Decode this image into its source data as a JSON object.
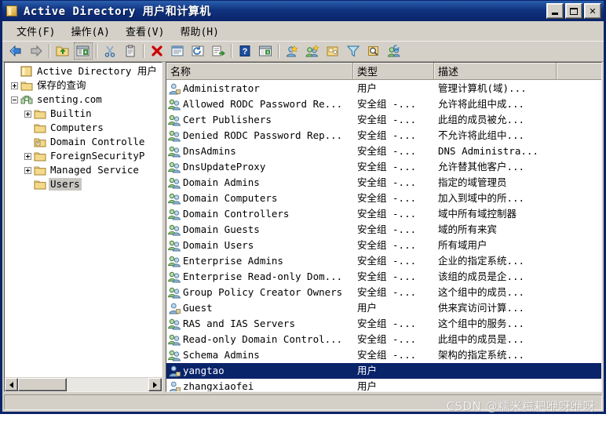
{
  "window": {
    "title": "Active Directory 用户和计算机",
    "icon": "folder-icon",
    "minimize_label": "最小化",
    "maximize_label": "最大化",
    "close_label": "✕"
  },
  "menu": {
    "items": [
      {
        "label": "文件(F)",
        "name": "menu-file"
      },
      {
        "label": "操作(A)",
        "name": "menu-action"
      },
      {
        "label": "查看(V)",
        "name": "menu-view"
      },
      {
        "label": "帮助(H)",
        "name": "menu-help"
      }
    ]
  },
  "toolbar": {
    "buttons": [
      {
        "icon": "back-arrow-icon",
        "label": "后退"
      },
      {
        "icon": "forward-arrow-icon",
        "label": "前进"
      },
      {
        "sep": true
      },
      {
        "icon": "up-folder-icon",
        "label": "上一级"
      },
      {
        "icon": "show-console-tree-icon",
        "label": "显示/隐藏控制台树",
        "pressed": true
      },
      {
        "sep": true
      },
      {
        "icon": "cut-scissors-icon",
        "label": "剪切"
      },
      {
        "icon": "paste-clipboard-icon",
        "label": "粘贴"
      },
      {
        "sep": true
      },
      {
        "icon": "delete-x-icon",
        "label": "删除"
      },
      {
        "icon": "properties-icon",
        "label": "属性"
      },
      {
        "icon": "refresh-icon",
        "label": "刷新"
      },
      {
        "icon": "export-list-icon",
        "label": "导出列表"
      },
      {
        "sep": true
      },
      {
        "icon": "help-question-icon",
        "label": "帮助"
      },
      {
        "icon": "console-window-icon",
        "label": "新建窗口"
      },
      {
        "sep": true
      },
      {
        "icon": "new-user-icon",
        "label": "新建用户"
      },
      {
        "icon": "new-group-icon",
        "label": "新建组"
      },
      {
        "icon": "new-ou-icon",
        "label": "新建组织单位"
      },
      {
        "icon": "filter-funnel-icon",
        "label": "筛选"
      },
      {
        "icon": "find-icon",
        "label": "查找"
      },
      {
        "icon": "add-members-icon",
        "label": "添加成员"
      }
    ]
  },
  "tree": {
    "nodes": [
      {
        "label": "Active Directory 用户",
        "icon": "console-root-icon",
        "indent": 0,
        "expander": "none",
        "selected": false
      },
      {
        "label": "保存的查询",
        "icon": "folder-icon",
        "indent": 1,
        "expander": "plus",
        "selected": false
      },
      {
        "label": "senting.com",
        "icon": "domain-icon",
        "indent": 1,
        "expander": "minus",
        "selected": false
      },
      {
        "label": "Builtin",
        "icon": "folder-icon",
        "indent": 2,
        "expander": "plus",
        "selected": false
      },
      {
        "label": "Computers",
        "icon": "folder-icon",
        "indent": 2,
        "expander": "none",
        "selected": false
      },
      {
        "label": "Domain Controlle",
        "icon": "ou-icon",
        "indent": 2,
        "expander": "none",
        "selected": false
      },
      {
        "label": "ForeignSecurityP",
        "icon": "folder-icon",
        "indent": 2,
        "expander": "plus",
        "selected": false
      },
      {
        "label": "Managed Service ",
        "icon": "folder-icon",
        "indent": 2,
        "expander": "plus",
        "selected": false
      },
      {
        "label": "Users",
        "icon": "folder-icon",
        "indent": 2,
        "expander": "none",
        "selected": true
      }
    ],
    "hscroll": {
      "left_arrow": "◀",
      "right_arrow": "▶"
    }
  },
  "list": {
    "columns": [
      {
        "label": "名称",
        "name": "column-name"
      },
      {
        "label": "类型",
        "name": "column-type"
      },
      {
        "label": "描述",
        "name": "column-description"
      }
    ],
    "rows": [
      {
        "name": "Administrator",
        "type": "用户",
        "description": "管理计算机(域)...",
        "icon": "user-icon",
        "selected": false
      },
      {
        "name": "Allowed RODC Password Re...",
        "type": "安全组 -...",
        "description": "允许将此组中成...",
        "icon": "group-icon",
        "selected": false
      },
      {
        "name": "Cert Publishers",
        "type": "安全组 -...",
        "description": "此组的成员被允...",
        "icon": "group-icon",
        "selected": false
      },
      {
        "name": "Denied RODC Password Rep...",
        "type": "安全组 -...",
        "description": "不允许将此组中...",
        "icon": "group-icon",
        "selected": false
      },
      {
        "name": "DnsAdmins",
        "type": "安全组 -...",
        "description": "DNS Administra...",
        "icon": "group-icon",
        "selected": false
      },
      {
        "name": "DnsUpdateProxy",
        "type": "安全组 -...",
        "description": "允许替其他客户...",
        "icon": "group-icon",
        "selected": false
      },
      {
        "name": "Domain Admins",
        "type": "安全组 -...",
        "description": "指定的域管理员",
        "icon": "group-icon",
        "selected": false
      },
      {
        "name": "Domain Computers",
        "type": "安全组 -...",
        "description": "加入到域中的所...",
        "icon": "group-icon",
        "selected": false
      },
      {
        "name": "Domain Controllers",
        "type": "安全组 -...",
        "description": "域中所有域控制器",
        "icon": "group-icon",
        "selected": false
      },
      {
        "name": "Domain Guests",
        "type": "安全组 -...",
        "description": "域的所有来宾",
        "icon": "group-icon",
        "selected": false
      },
      {
        "name": "Domain Users",
        "type": "安全组 -...",
        "description": "所有域用户",
        "icon": "group-icon",
        "selected": false
      },
      {
        "name": "Enterprise Admins",
        "type": "安全组 -...",
        "description": "企业的指定系统...",
        "icon": "group-icon",
        "selected": false
      },
      {
        "name": "Enterprise Read-only Dom...",
        "type": "安全组 -...",
        "description": "该组的成员是企...",
        "icon": "group-icon",
        "selected": false
      },
      {
        "name": "Group Policy Creator Owners",
        "type": "安全组 -...",
        "description": "这个组中的成员...",
        "icon": "group-icon",
        "selected": false
      },
      {
        "name": "Guest",
        "type": "用户",
        "description": "供来宾访问计算...",
        "icon": "user-icon",
        "selected": false
      },
      {
        "name": "RAS and IAS Servers",
        "type": "安全组 -...",
        "description": "这个组中的服务...",
        "icon": "group-icon",
        "selected": false
      },
      {
        "name": "Read-only Domain Control...",
        "type": "安全组 -...",
        "description": "此组中的成员是...",
        "icon": "group-icon",
        "selected": false
      },
      {
        "name": "Schema Admins",
        "type": "安全组 -...",
        "description": "架构的指定系统...",
        "icon": "group-icon",
        "selected": false
      },
      {
        "name": "yangtao",
        "type": "用户",
        "description": "",
        "icon": "user-icon",
        "selected": true
      },
      {
        "name": "zhangxiaofei",
        "type": "用户",
        "description": "",
        "icon": "user-icon",
        "selected": false
      }
    ]
  },
  "watermark": {
    "text": "CSDN @糯米糍耙咿呀咿呀"
  },
  "colors": {
    "titlebar": "#0a246a",
    "selection": "#0a246a",
    "chrome": "#d4d0c8",
    "inactive_selection": "#c8c6c0"
  }
}
